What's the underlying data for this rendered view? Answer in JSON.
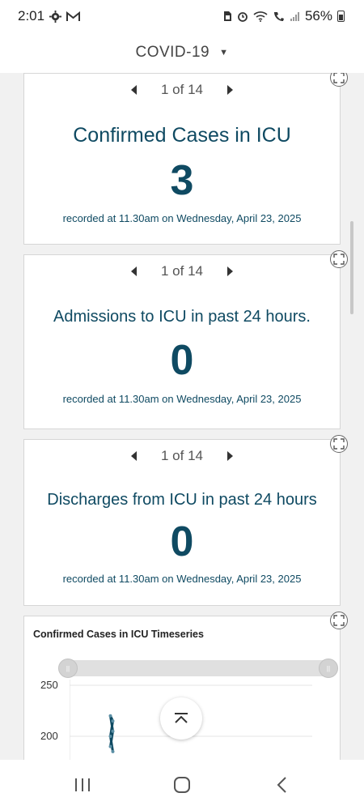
{
  "status_bar": {
    "time": "2:01",
    "battery": "56%",
    "left_icons": [
      "settings-notification-icon",
      "gmail-icon"
    ],
    "right_icons": [
      "sim-icon",
      "alarm-icon",
      "wifi-icon",
      "wifi-calling-icon",
      "signal-icon",
      "battery-icon"
    ]
  },
  "header": {
    "title": "COVID-19"
  },
  "cards": [
    {
      "pager": "1 of 14",
      "title": "Confirmed Cases in ICU",
      "value": "3",
      "recorded": "recorded at 11.30am on Wednesday, April 23, 2025"
    },
    {
      "pager": "1 of 14",
      "title": "Admissions to ICU in past 24 hours.",
      "value": "0",
      "recorded": "recorded at 11.30am on Wednesday, April 23, 2025"
    },
    {
      "pager": "1 of 14",
      "title": "Discharges from ICU in past 24 hours",
      "value": "0",
      "recorded": "recorded at 11.30am on Wednesday, April 23, 2025"
    }
  ],
  "timeseries": {
    "title": "Confirmed Cases in ICU Timeseries"
  },
  "chart_data": {
    "type": "line",
    "title": "Confirmed Cases in ICU Timeseries",
    "y_ticks": [
      250,
      200
    ],
    "ylim": [
      180,
      250
    ],
    "grid": true,
    "series": [
      {
        "values": [
          190,
          205,
          220,
          215,
          200,
          185
        ]
      }
    ]
  },
  "colors": {
    "accent": "#0f4a62",
    "card_border": "#d6d6d6",
    "background": "#f1f1f1"
  }
}
